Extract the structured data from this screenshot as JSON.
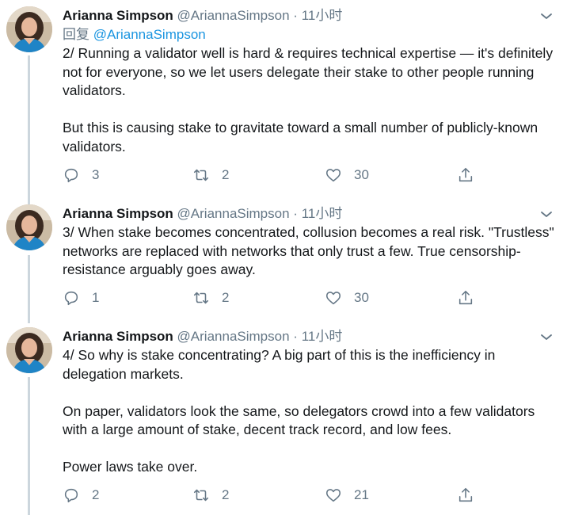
{
  "tweets": [
    {
      "author_name": "Arianna Simpson",
      "handle": "@AriannaSimpson",
      "separator": "·",
      "time": "11小时",
      "reply_prefix": "回复",
      "reply_mention": "@AriannaSimpson",
      "paragraphs": [
        "2/ Running a validator well is hard & requires technical expertise — it's definitely not for everyone, so we let users delegate their stake to other people running validators.",
        "But this is causing stake to gravitate toward a small number of publicly-known validators."
      ],
      "replies": "3",
      "retweets": "2",
      "likes": "30"
    },
    {
      "author_name": "Arianna Simpson",
      "handle": "@AriannaSimpson",
      "separator": "·",
      "time": "11小时",
      "paragraphs": [
        "3/ When stake becomes concentrated, collusion becomes a real risk. \"Trustless\" networks are replaced with networks that only trust a few. True censorship-resistance arguably goes away."
      ],
      "replies": "1",
      "retweets": "2",
      "likes": "30"
    },
    {
      "author_name": "Arianna Simpson",
      "handle": "@AriannaSimpson",
      "separator": "·",
      "time": "11小时",
      "paragraphs": [
        "4/ So why is stake concentrating? A big part of this is the inefficiency in delegation markets.",
        "On paper, validators look the same, so delegators crowd into a few validators with a large amount of stake, decent track record, and low fees.",
        "Power laws take over."
      ],
      "replies": "2",
      "retweets": "2",
      "likes": "21"
    }
  ],
  "icons": {
    "reply": "reply-icon",
    "retweet": "retweet-icon",
    "like": "heart-icon",
    "share": "share-icon",
    "menu": "chevron-down-icon"
  },
  "colors": {
    "link": "#1b95e0",
    "muted": "#657786",
    "thread_line": "#ccd6dd"
  }
}
